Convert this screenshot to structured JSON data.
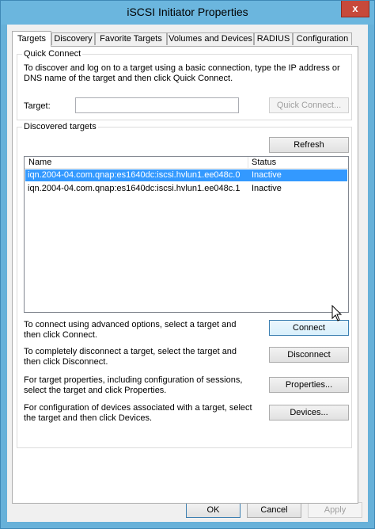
{
  "window": {
    "title": "iSCSI Initiator Properties",
    "close_glyph": "x"
  },
  "tabs": [
    {
      "label": "Targets",
      "active": true
    },
    {
      "label": "Discovery",
      "active": false
    },
    {
      "label": "Favorite Targets",
      "active": false
    },
    {
      "label": "Volumes and Devices",
      "active": false
    },
    {
      "label": "RADIUS",
      "active": false
    },
    {
      "label": "Configuration",
      "active": false
    }
  ],
  "quick_connect": {
    "group_label": "Quick Connect",
    "description": "To discover and log on to a target using a basic connection, type the IP address or DNS name of the target and then click Quick Connect.",
    "target_label": "Target:",
    "target_value": "",
    "button_label": "Quick Connect..."
  },
  "discovered": {
    "group_label": "Discovered targets",
    "refresh_label": "Refresh",
    "columns": [
      "Name",
      "Status"
    ],
    "rows": [
      {
        "name": "iqn.2004-04.com.qnap:es1640dc:iscsi.hvlun1.ee048c.0",
        "status": "Inactive",
        "selected": true
      },
      {
        "name": "iqn.2004-04.com.qnap:es1640dc:iscsi.hvlun1.ee048c.1",
        "status": "Inactive",
        "selected": false
      }
    ]
  },
  "actions": [
    {
      "description": "To connect using advanced options, select a target and then click Connect.",
      "button": "Connect"
    },
    {
      "description": "To completely disconnect a target, select the target and then click Disconnect.",
      "button": "Disconnect"
    },
    {
      "description": "For target properties, including configuration of sessions, select the target and click Properties.",
      "button": "Properties..."
    },
    {
      "description": "For configuration of devices associated with a target, select the target and then click Devices.",
      "button": "Devices..."
    }
  ],
  "footer": {
    "ok": "OK",
    "cancel": "Cancel",
    "apply": "Apply"
  },
  "colors": {
    "title_bar": "#6bb6de",
    "close_button": "#c7493a",
    "selection": "#3399ff"
  }
}
